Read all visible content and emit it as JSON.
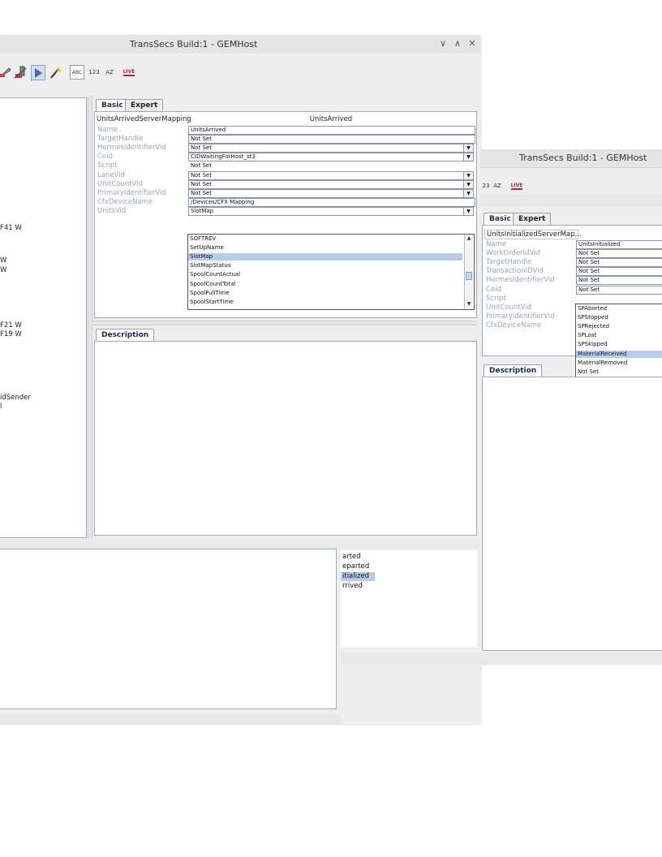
{
  "window1": {
    "title": "TransSecs Build:1 - GEMHost",
    "controls": [
      "∨",
      "∧",
      "✕"
    ],
    "toolbar_icons": [
      "wrench-icon",
      "tools-icon",
      "play-icon",
      "wand-icon",
      "abc-icon",
      "123-icon",
      "sort-az-icon",
      "live-icon"
    ],
    "toolbar_texts": {
      "abc": "ABC",
      "n123": "123",
      "az": "AZ",
      "live": "LIVE"
    },
    "tabs": [
      "Basic",
      "Expert"
    ],
    "table_header": {
      "name": "UnitsArrivedServerMapping",
      "value": "UnitsArrived"
    },
    "properties": [
      {
        "label": "Name",
        "value": "UnitsArrived",
        "dropdown": false,
        "plain": false
      },
      {
        "label": "TargetHandle",
        "value": "Not Set",
        "dropdown": false,
        "plain": false
      },
      {
        "label": "HermesIdentifierVid",
        "value": "Not Set",
        "dropdown": true,
        "plain": false
      },
      {
        "label": "Ceid",
        "value": "CIDWaitingForHost_st3",
        "dropdown": true,
        "plain": false
      },
      {
        "label": "Script",
        "value": "Not Set",
        "dropdown": false,
        "plain": true
      },
      {
        "label": "LaneVid",
        "value": "Not Set",
        "dropdown": true,
        "plain": false
      },
      {
        "label": "UnitCountVid",
        "value": "Not Set",
        "dropdown": true,
        "plain": false
      },
      {
        "label": "PrimaryIdentifierVid",
        "value": "Not Set",
        "dropdown": true,
        "plain": false
      },
      {
        "label": "CfxDeviceName",
        "value": "/Devices/CFX Mapping",
        "dropdown": false,
        "plain": false
      },
      {
        "label": "UnitsVid",
        "value": "SlotMap",
        "dropdown": true,
        "plain": false
      }
    ],
    "units_vid_options": [
      "SOFTREV",
      "SetUpName",
      "SlotMap",
      "SlotMapStatus",
      "SpoolCountActual",
      "SpoolCountTotal",
      "SpoolFullTime",
      "SpoolStartTime"
    ],
    "units_vid_selected_index": 2,
    "description_tab": "Description",
    "left_tree_fragments": [
      "F41 W",
      "W",
      "W",
      "F21 W",
      "F19 W",
      "idSender",
      "l"
    ],
    "bottom_list": [
      "arted",
      "eparted",
      "itialized",
      "rrived"
    ],
    "bottom_list_selected_index": 2
  },
  "window2": {
    "title": "TransSecs Build:1 - GEMHost",
    "toolbar_texts": {
      "n123": "23",
      "az": "AZ",
      "live": "LIVE"
    },
    "tabs": [
      "Basic",
      "Expert"
    ],
    "table_header": {
      "name": "UnitsInitializedServerMap...",
      "value": ""
    },
    "properties": [
      {
        "label": "Name",
        "value": "UnitsInitialized"
      },
      {
        "label": "WorkOrderIdVid",
        "value": "Not Set"
      },
      {
        "label": "TargetHandle",
        "value": "Not Set"
      },
      {
        "label": "TransactionIDVid",
        "value": "Not Set"
      },
      {
        "label": "HermesIdentifierVid",
        "value": "Not Set"
      },
      {
        "label": "Ceid",
        "value": "Not Set"
      }
    ],
    "extra_labels": [
      "Script",
      "UnitCountVid",
      "PrimaryIdentifierVid",
      "CfxDeviceName"
    ],
    "ceid_options": [
      "SPAborted",
      "SPStopped",
      "SPRejected",
      "SPLost",
      "SPSkipped",
      "MaterialReceived",
      "MaterialRemoved",
      "Not Set"
    ],
    "ceid_selected_index": 5,
    "description_tab": "Description"
  }
}
